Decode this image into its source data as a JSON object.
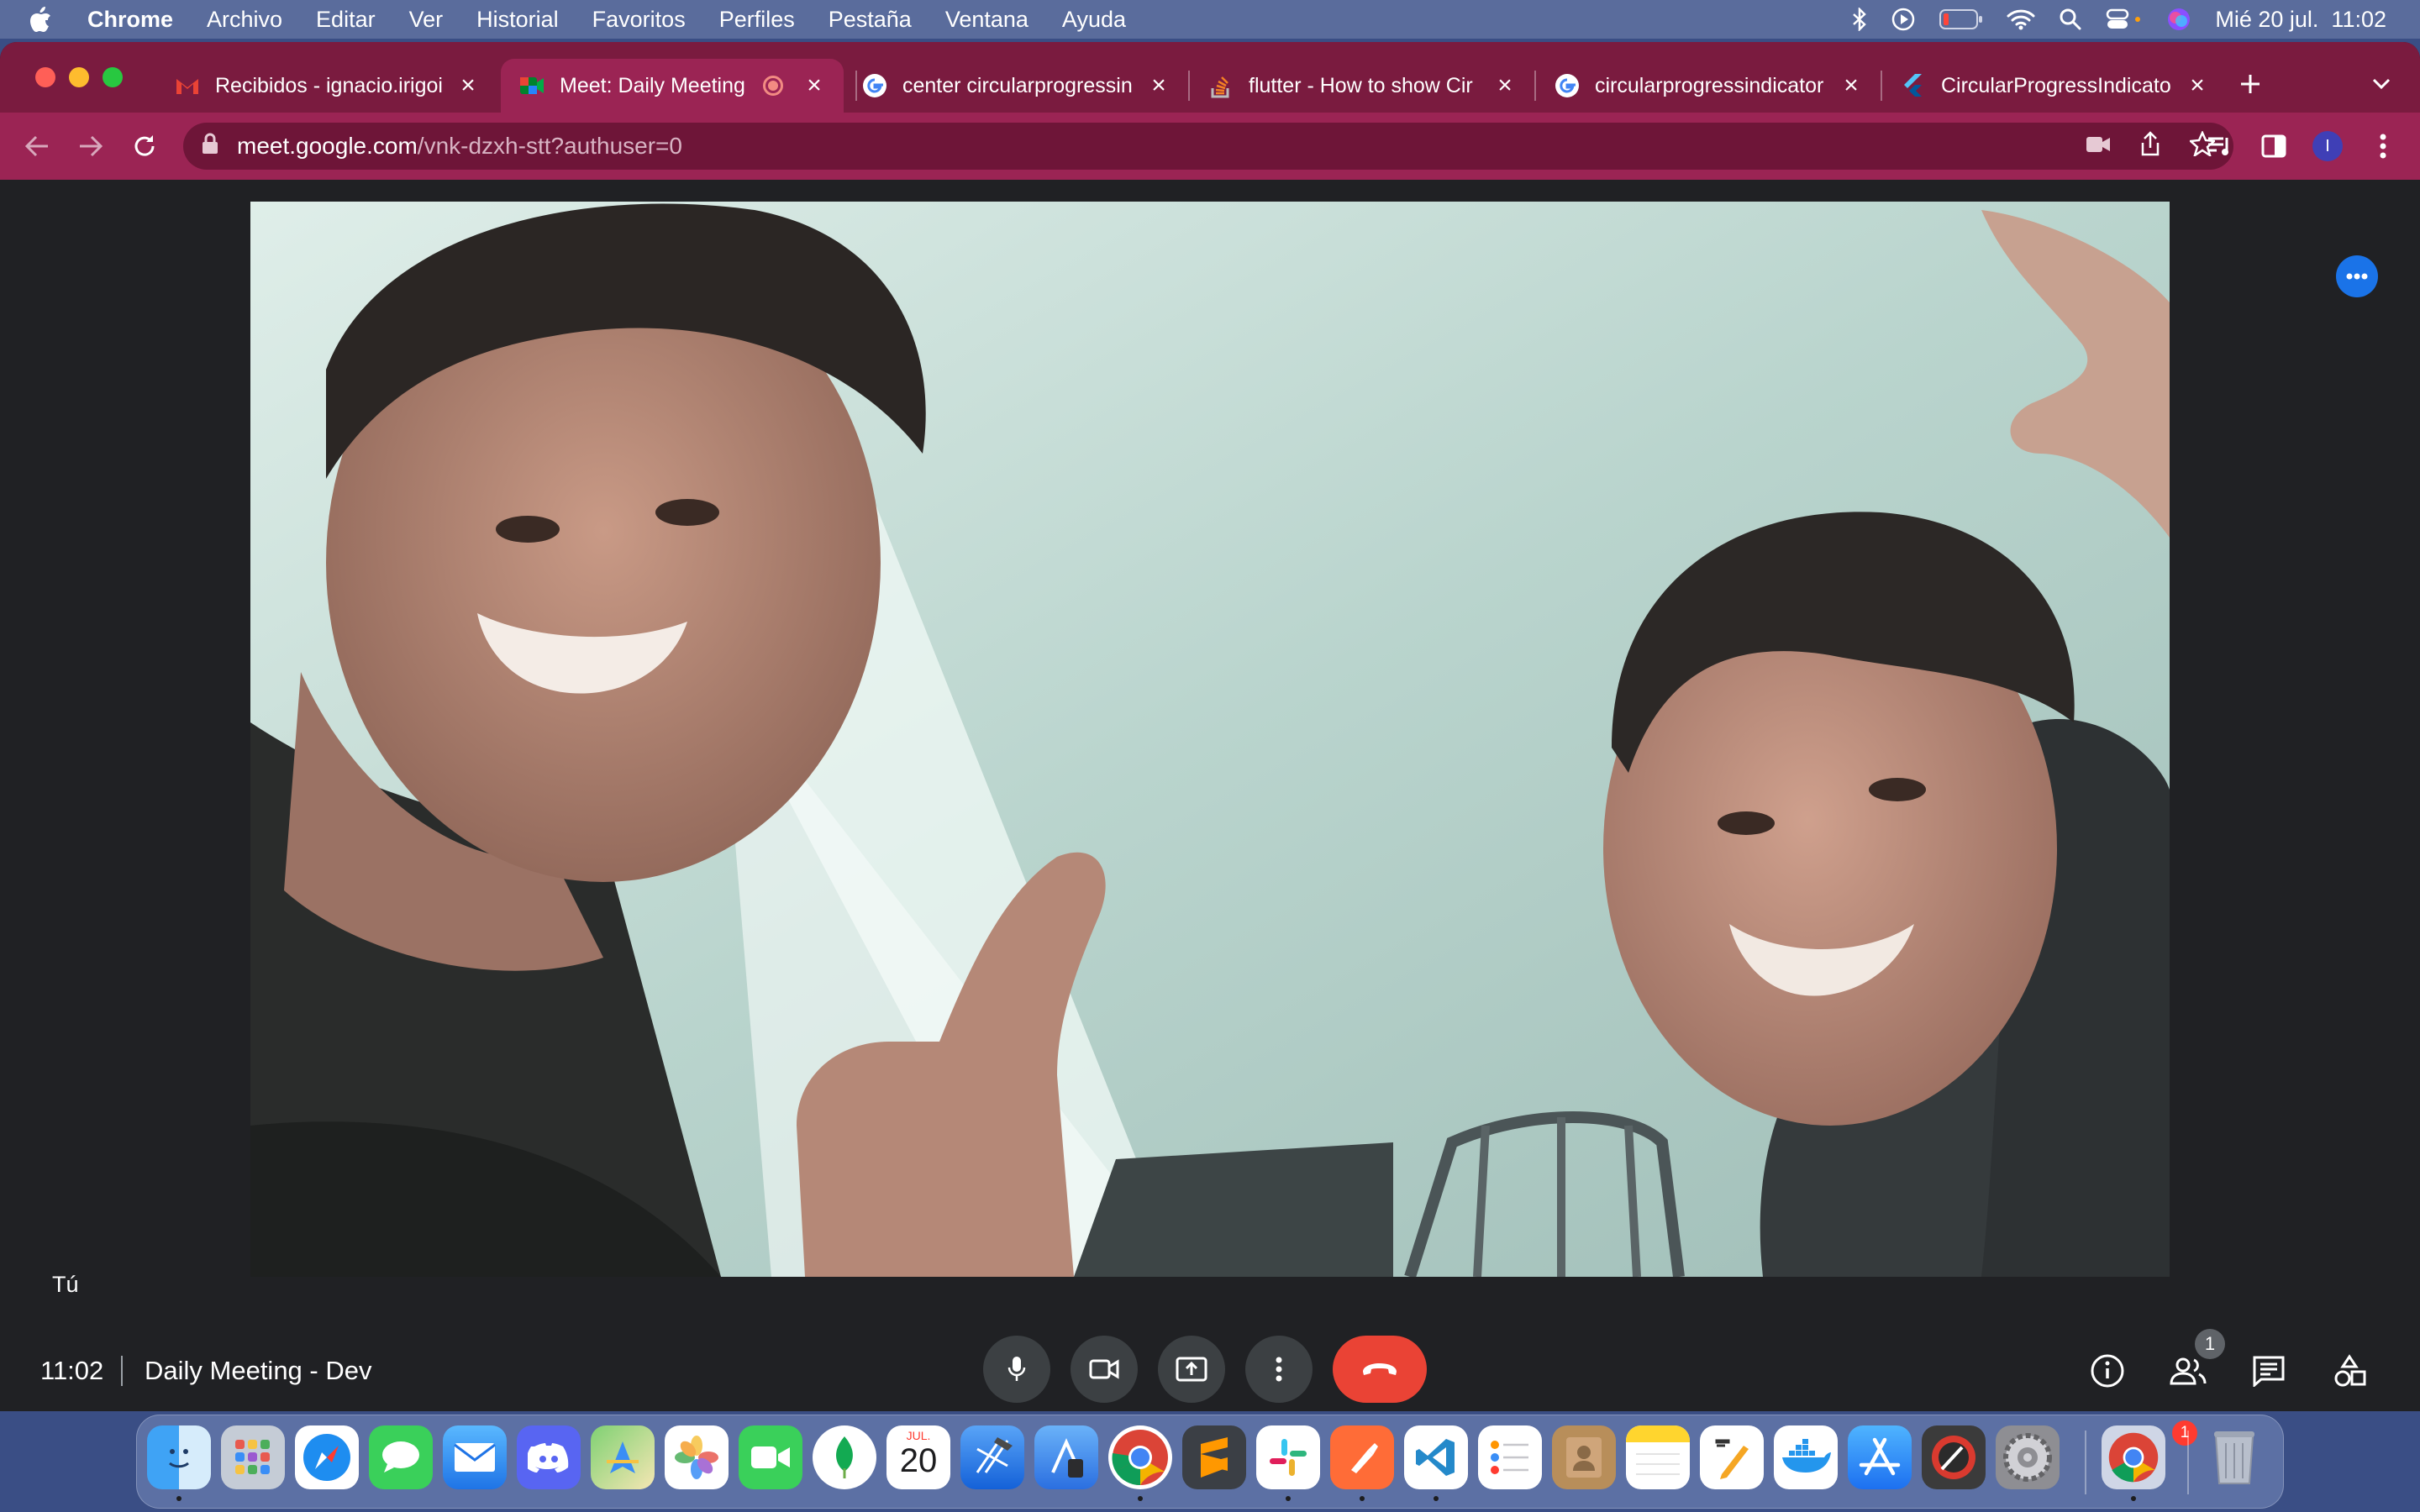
{
  "menubar": {
    "app_name": "Chrome",
    "items": [
      "Archivo",
      "Editar",
      "Ver",
      "Historial",
      "Favoritos",
      "Perfiles",
      "Pestaña",
      "Ventana",
      "Ayuda"
    ],
    "datetime": "Mié 20 jul.  11:02"
  },
  "browser": {
    "tabs": [
      {
        "title": "Recibidos - ignacio.irigoi",
        "favicon": "gmail-icon"
      },
      {
        "title": "Meet: Daily Meeting",
        "favicon": "meet-icon",
        "active": true,
        "recording": true
      },
      {
        "title": "center circularprogressin",
        "favicon": "google-icon"
      },
      {
        "title": "flutter - How to show Cir",
        "favicon": "stackoverflow-icon"
      },
      {
        "title": "circularprogressindicator",
        "favicon": "google-icon"
      },
      {
        "title": "CircularProgressIndicato",
        "favicon": "flutter-icon"
      }
    ],
    "url_host": "meet.google.com",
    "url_path": "/vnk-dzxh-stt?authuser=0",
    "profile_initial": "I"
  },
  "meet": {
    "self_label": "Tú",
    "time": "11:02",
    "meeting_name": "Daily Meeting - Dev",
    "participants_count": "1"
  },
  "dock": {
    "settings_badge": "1",
    "calendar_month": "JUL.",
    "calendar_day": "20"
  },
  "colors": {
    "tab_strip": "#7a1b3f",
    "toolbar": "#9b2454",
    "meet_bg": "#202124",
    "end_call": "#ea4335",
    "accent": "#1a73e8"
  }
}
